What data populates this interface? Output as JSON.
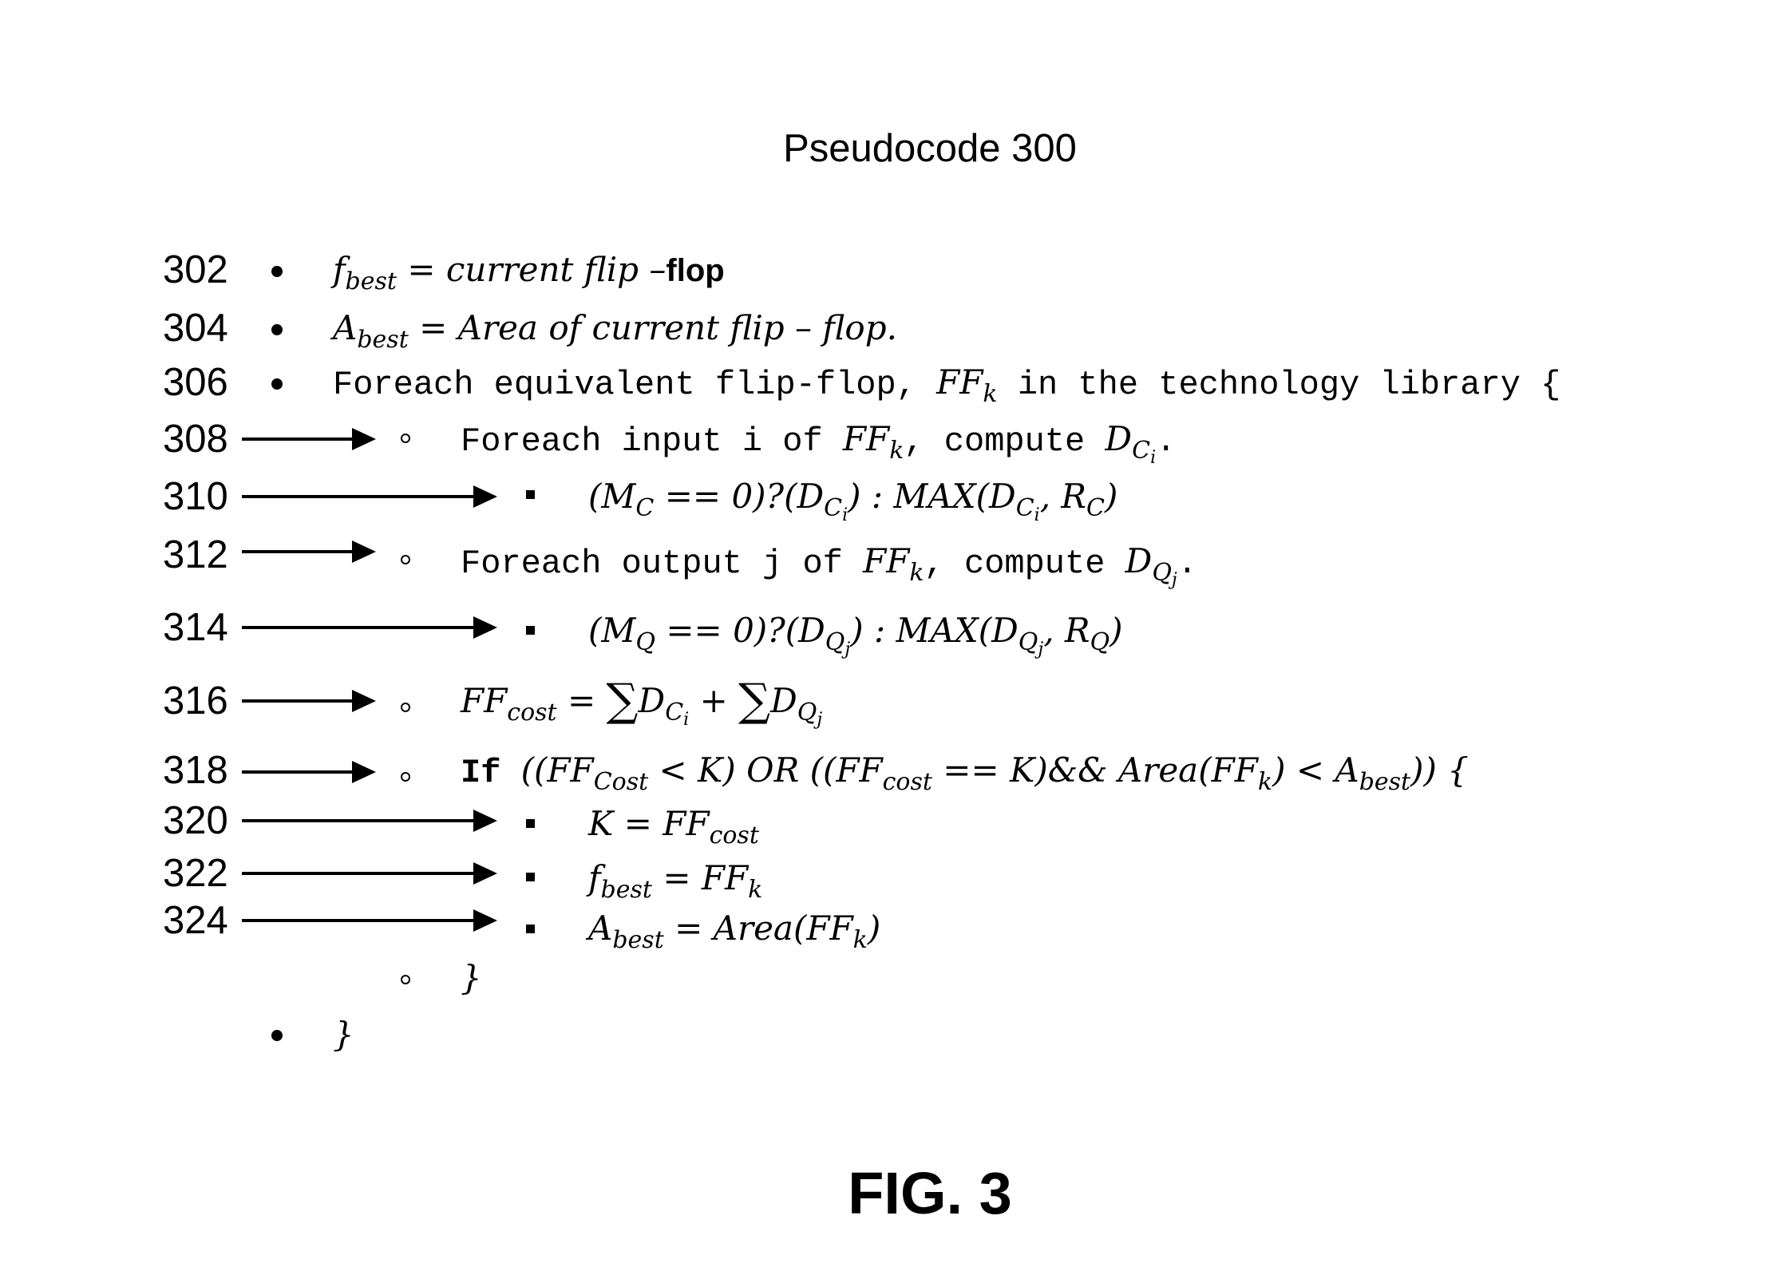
{
  "title": "Pseudocode 300",
  "figure_label": "FIG. 3",
  "lines": [
    {
      "ref": "302",
      "level": 0,
      "arrow": "none",
      "bullet": "filled-circle",
      "text": "f_best = current flip –flop",
      "parts": {
        "var": "f",
        "sub": "best",
        "rest": " = current flip –",
        "tail": "flop"
      }
    },
    {
      "ref": "304",
      "level": 0,
      "arrow": "none",
      "bullet": "filled-circle",
      "text": "A_best = Area of current flip – flop.",
      "parts": {
        "var": "A",
        "sub": "best",
        "rest": " = Area of current flip – flop."
      }
    },
    {
      "ref": "306",
      "level": 0,
      "arrow": "none",
      "bullet": "filled-circle",
      "text": "Foreach equivalent flip-flop, FF_k in the technology library {",
      "parts": {
        "pre": "Foreach equivalent flip-flop, ",
        "var": "FF",
        "sub": "k",
        "post": " in the technology library {"
      }
    },
    {
      "ref": "308",
      "level": 1,
      "arrow": "short",
      "bullet": "open-circle",
      "text": "Foreach input i of FF_k, compute D_Ci.",
      "parts": {
        "pre": "Foreach input i of ",
        "var": "FF",
        "sub": "k",
        "mid": ", compute ",
        "var2": "D",
        "sub2": "C",
        "subsub2": "i",
        "post": "."
      }
    },
    {
      "ref": "310",
      "level": 2,
      "arrow": "long",
      "bullet": "filled-square",
      "text": "(M_C == 0)?(D_Ci) : MAX(D_Ci, R_C)",
      "parts": {
        "a": "(M",
        "a_sub": "C",
        "b": " == 0)?(D",
        "b_sub": "C",
        "b_subsub": "i",
        "c": ") : MAX(D",
        "c_sub": "C",
        "c_subsub": "i",
        "d": ", R",
        "d_sub": "C",
        "e": ")"
      }
    },
    {
      "ref": "312",
      "level": 1,
      "arrow": "short",
      "bullet": "open-circle",
      "text": "Foreach output j of FF_k, compute D_Qj.",
      "parts": {
        "pre": "Foreach output j of ",
        "var": "FF",
        "sub": "k",
        "mid": ", compute ",
        "var2": "D",
        "sub2": "Q",
        "subsub2": "j",
        "post": "."
      }
    },
    {
      "ref": "314",
      "level": 2,
      "arrow": "long",
      "bullet": "filled-square",
      "text": "(M_Q == 0)?(D_Qj) : MAX(D_Qj, R_Q)",
      "parts": {
        "a": "(M",
        "a_sub": "Q",
        "b": " == 0)?(D",
        "b_sub": "Q",
        "b_subsub": "j",
        "c": ") : MAX(D",
        "c_sub": "Q",
        "c_subsub": "j",
        "d": ", R",
        "d_sub": "Q",
        "e": ")"
      }
    },
    {
      "ref": "316",
      "level": 1,
      "arrow": "short",
      "bullet": "open-circle",
      "text": "FF_cost = ∑D_Ci + ∑D_Qj",
      "parts": {
        "a": "FF",
        "a_sub": "cost",
        "b": " = ",
        "sigma": "∑",
        "c": "D",
        "c_sub": "C",
        "c_subsub": "i",
        "d": " + ",
        "e": "D",
        "e_sub": "Q",
        "e_subsub": "j"
      }
    },
    {
      "ref": "318",
      "level": 1,
      "arrow": "short",
      "bullet": "open-circle",
      "text": "If ((FF_Cost < K) OR ((FF_cost == K)&& Area(FF_k) < A_best)) {",
      "parts": {
        "kw": "If ",
        "a": "((FF",
        "a_sub": "Cost",
        "b": " < K) OR ((FF",
        "b_sub": "cost",
        "c": " == K)&& Area(FF",
        "c_sub": "k",
        "d": ") < A",
        "d_sub": "best",
        "e": ")) {"
      }
    },
    {
      "ref": "320",
      "level": 2,
      "arrow": "long",
      "bullet": "filled-square",
      "text": "K = FF_cost",
      "parts": {
        "a": "K = FF",
        "a_sub": "cost"
      }
    },
    {
      "ref": "322",
      "level": 2,
      "arrow": "long",
      "bullet": "filled-square",
      "text": "f_best = FF_k",
      "parts": {
        "a": "f",
        "a_sub": "best",
        "b": " = FF",
        "b_sub": "k"
      }
    },
    {
      "ref": "324",
      "level": 2,
      "arrow": "long",
      "bullet": "filled-square",
      "text": "A_best = Area(FF_k)",
      "parts": {
        "a": "A",
        "a_sub": "best",
        "b": " = Area(FF",
        "b_sub": "k",
        "c": ")"
      }
    },
    {
      "ref": "",
      "level": 1,
      "arrow": "none",
      "bullet": "open-circle",
      "text": "}"
    },
    {
      "ref": "",
      "level": 0,
      "arrow": "none",
      "bullet": "filled-circle",
      "text": "}"
    }
  ]
}
